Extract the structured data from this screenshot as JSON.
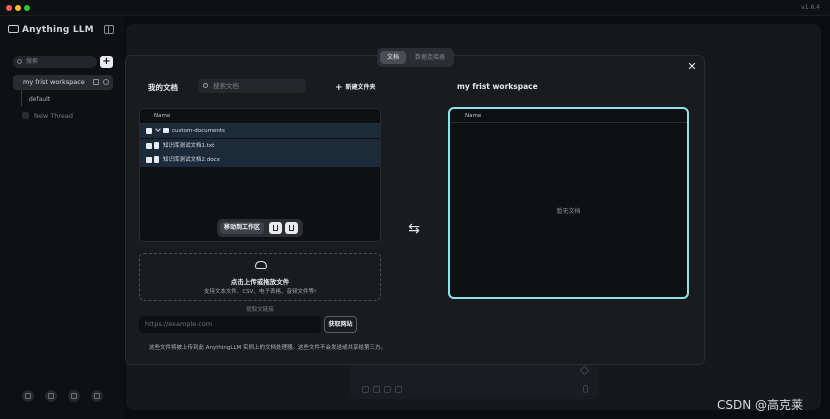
{
  "app": {
    "version": "v1.6.4"
  },
  "sidebar": {
    "brand": "Anything LLM",
    "search_placeholder": "搜索",
    "add_label": "+",
    "workspace": "my frist workspace",
    "thread_default": "default",
    "new_thread": "New Thread"
  },
  "modal": {
    "tabs": [
      "文档",
      "数据连接器"
    ],
    "close_label": "✕",
    "my_docs_title": "我的文档",
    "search_placeholder": "搜索文档",
    "new_folder": "新建文件夹",
    "column_name": "Name",
    "files": [
      {
        "name": "custom-documents",
        "type": "folder"
      },
      {
        "name": "知识库测试文档1.txt",
        "type": "file"
      },
      {
        "name": "知识库测试文档2.docx",
        "type": "file"
      }
    ],
    "move_to_workspace": "移动到工作区",
    "upload_title": "点击上传或拖放文件",
    "upload_subtitle": "支持文本文件、CSV、电子表格、音频文件等!",
    "link_label": "提取文链接",
    "url_placeholder": "https://example.com",
    "fetch_button": "获取网站",
    "footnote": "这些文件将被上传到此 AnythingLLM 实例上的文档处理器。这些文件不会发送或共享给第三方。",
    "swap_icon": "⇆",
    "workspace_title": "my frist workspace",
    "workspace_column": "Name",
    "workspace_empty": "暂无文档"
  },
  "watermark": "CSDN @高克莱",
  "colors": {
    "accent_border": "#8fe3e8",
    "selected_row": "#1b2b3a"
  }
}
